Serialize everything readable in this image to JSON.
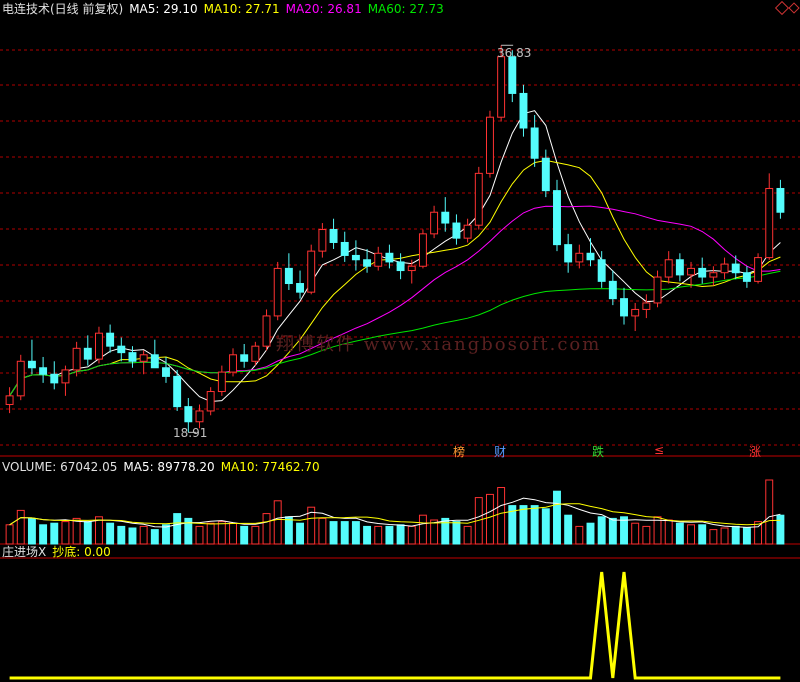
{
  "header": {
    "title": "电连技术(日线 前复权)",
    "ma5": "MA5: 29.10",
    "ma10": "MA10: 27.71",
    "ma20": "MA20: 26.81",
    "ma60": "MA60: 27.73"
  },
  "volume_header": {
    "volume": "VOLUME: 67042.05",
    "ma5": "MA5: 89778.20",
    "ma10": "MA10: 77462.70"
  },
  "indicator_header": {
    "name": "庄进场X",
    "value": "抄底: 0.00"
  },
  "price_labels": {
    "high": "36.83",
    "low": "18.91"
  },
  "watermark": "翔博软件 www.xiangbosoft.com",
  "event_tags": [
    "榜",
    "财",
    "跌",
    "≤",
    "涨"
  ],
  "colors": {
    "background": "#000000",
    "up": "#ff3232",
    "down": "#54fcfc",
    "ma5": "#ffffff",
    "ma10": "#ffff00",
    "ma20": "#ff00ff",
    "ma60": "#00e600",
    "grid": "#b00000",
    "indicator": "#ffff00"
  },
  "chart_data": {
    "type": "candlestick",
    "title": "电连技术(日线 前复权)",
    "highest": 36.83,
    "lowest": 18.91,
    "ylim": [
      18,
      38
    ],
    "candles": [
      [
        20.2,
        21.0,
        19.8,
        20.6
      ],
      [
        20.6,
        22.5,
        20.4,
        22.2
      ],
      [
        22.2,
        23.2,
        21.6,
        21.9
      ],
      [
        21.9,
        22.4,
        21.2,
        21.6
      ],
      [
        21.6,
        22.2,
        20.9,
        21.2
      ],
      [
        21.2,
        22.0,
        20.6,
        21.8
      ],
      [
        21.8,
        23.1,
        21.5,
        22.8
      ],
      [
        22.8,
        23.4,
        22.0,
        22.3
      ],
      [
        22.3,
        23.8,
        22.1,
        23.5
      ],
      [
        23.5,
        23.9,
        22.6,
        22.9
      ],
      [
        22.9,
        23.3,
        22.2,
        22.6
      ],
      [
        22.6,
        22.9,
        21.9,
        22.2
      ],
      [
        22.2,
        22.7,
        21.6,
        22.5
      ],
      [
        22.5,
        23.2,
        22.3,
        21.9
      ],
      [
        21.9,
        22.4,
        21.2,
        21.5
      ],
      [
        21.5,
        21.8,
        19.9,
        20.1
      ],
      [
        20.1,
        20.5,
        18.9,
        19.4
      ],
      [
        19.4,
        20.2,
        19.1,
        19.9
      ],
      [
        19.9,
        21.0,
        19.7,
        20.8
      ],
      [
        20.8,
        22.0,
        20.6,
        21.7
      ],
      [
        21.7,
        22.8,
        21.5,
        22.5
      ],
      [
        22.5,
        23.0,
        21.9,
        22.2
      ],
      [
        22.2,
        23.1,
        22.0,
        22.9
      ],
      [
        22.9,
        24.6,
        22.7,
        24.3
      ],
      [
        24.3,
        26.8,
        24.1,
        26.5
      ],
      [
        26.5,
        27.2,
        25.5,
        25.8
      ],
      [
        25.8,
        26.4,
        25.1,
        25.4
      ],
      [
        25.4,
        27.6,
        25.3,
        27.3
      ],
      [
        27.3,
        28.6,
        27.0,
        28.3
      ],
      [
        28.3,
        28.8,
        27.4,
        27.7
      ],
      [
        27.7,
        28.2,
        26.8,
        27.1
      ],
      [
        27.1,
        27.8,
        26.4,
        26.9
      ],
      [
        26.9,
        27.4,
        26.3,
        26.6
      ],
      [
        26.6,
        27.5,
        26.4,
        27.2
      ],
      [
        27.2,
        27.6,
        26.5,
        26.8
      ],
      [
        26.8,
        27.2,
        26.0,
        26.4
      ],
      [
        26.4,
        26.9,
        25.8,
        26.6
      ],
      [
        26.6,
        28.3,
        26.5,
        28.1
      ],
      [
        28.1,
        29.4,
        27.9,
        29.1
      ],
      [
        29.1,
        29.8,
        28.2,
        28.6
      ],
      [
        28.6,
        29.0,
        27.6,
        27.9
      ],
      [
        27.9,
        28.8,
        27.7,
        28.5
      ],
      [
        28.5,
        31.2,
        28.3,
        30.9
      ],
      [
        30.9,
        33.8,
        30.7,
        33.5
      ],
      [
        33.5,
        36.83,
        33.3,
        36.3
      ],
      [
        36.3,
        36.6,
        34.2,
        34.6
      ],
      [
        34.6,
        35.0,
        32.6,
        33.0
      ],
      [
        33.0,
        33.6,
        31.2,
        31.6
      ],
      [
        31.6,
        32.0,
        29.8,
        30.1
      ],
      [
        30.1,
        30.6,
        27.3,
        27.6
      ],
      [
        27.6,
        28.1,
        26.3,
        26.8
      ],
      [
        26.8,
        27.6,
        26.5,
        27.2
      ],
      [
        27.2,
        27.9,
        26.6,
        26.9
      ],
      [
        26.9,
        27.3,
        25.6,
        25.9
      ],
      [
        25.9,
        26.4,
        24.8,
        25.1
      ],
      [
        25.1,
        25.6,
        23.9,
        24.3
      ],
      [
        24.3,
        24.9,
        23.6,
        24.6
      ],
      [
        24.6,
        25.3,
        24.2,
        24.9
      ],
      [
        24.9,
        26.4,
        24.7,
        26.1
      ],
      [
        26.1,
        27.3,
        25.8,
        26.9
      ],
      [
        26.9,
        27.2,
        25.9,
        26.2
      ],
      [
        26.2,
        26.8,
        25.6,
        26.5
      ],
      [
        26.5,
        27.0,
        25.8,
        26.1
      ],
      [
        26.1,
        26.6,
        25.7,
        26.3
      ],
      [
        26.3,
        27.0,
        26.0,
        26.7
      ],
      [
        26.7,
        27.1,
        26.0,
        26.3
      ],
      [
        26.3,
        26.6,
        25.6,
        25.9
      ],
      [
        25.9,
        27.2,
        25.8,
        27.0
      ],
      [
        27.0,
        30.9,
        26.9,
        30.2
      ],
      [
        30.2,
        30.6,
        28.8,
        29.1
      ]
    ]
  }
}
